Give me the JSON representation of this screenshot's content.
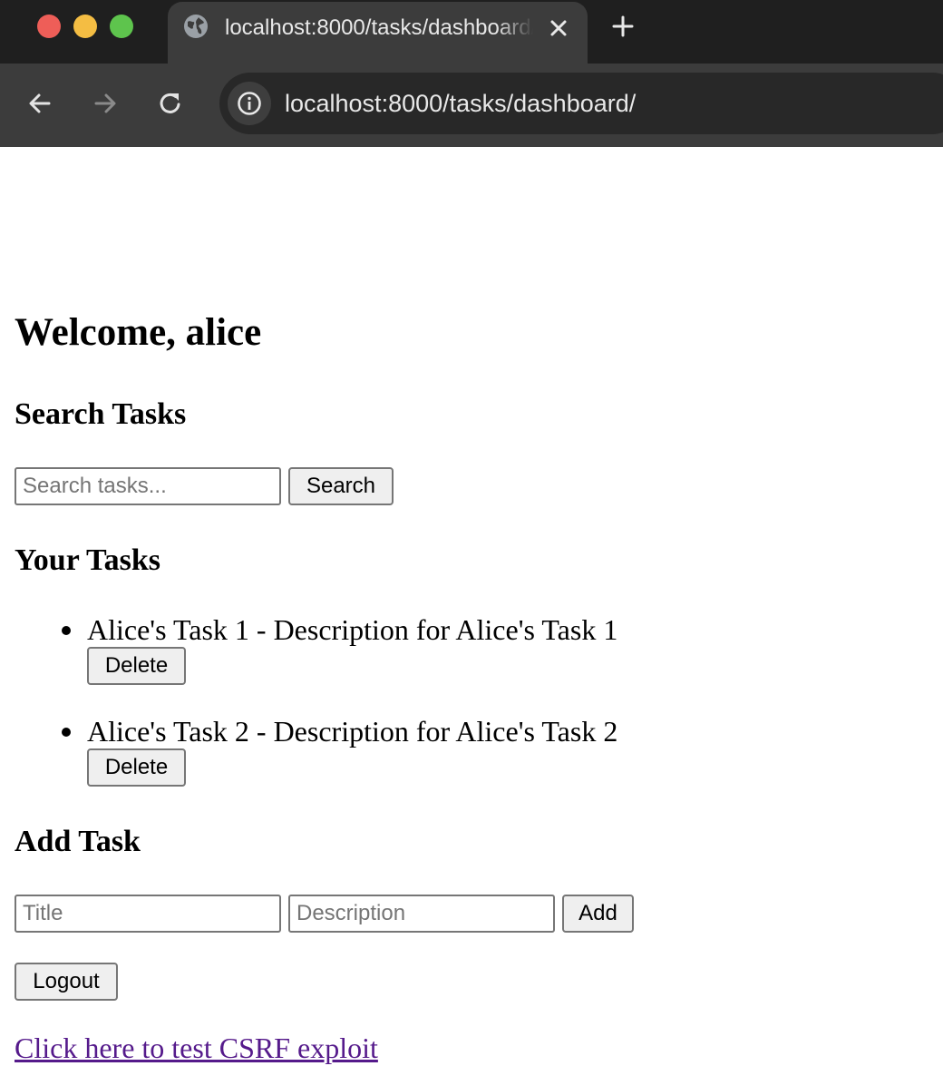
{
  "browser": {
    "tab_title": "localhost:8000/tasks/dashboard/",
    "url": "localhost:8000/tasks/dashboard/",
    "icons": {
      "tab_favicon": "globe-icon",
      "tab_close": "close-icon",
      "new_tab": "plus-icon",
      "back": "arrow-left-icon",
      "forward": "arrow-right-icon",
      "reload": "reload-icon",
      "site_info": "info-icon"
    }
  },
  "page": {
    "welcome_heading": "Welcome, alice",
    "search": {
      "heading": "Search Tasks",
      "input_value": "",
      "input_placeholder": "Search tasks...",
      "button_label": "Search"
    },
    "tasks": {
      "heading": "Your Tasks",
      "items": [
        {
          "text": "Alice's Task 1 - Description for Alice's Task 1",
          "delete_label": "Delete"
        },
        {
          "text": "Alice's Task 2 - Description for Alice's Task 2",
          "delete_label": "Delete"
        }
      ]
    },
    "add_task": {
      "heading": "Add Task",
      "title_placeholder": "Title",
      "description_placeholder": "Description",
      "button_label": "Add"
    },
    "logout_label": "Logout",
    "csrf_link_text": "Click here to test CSRF exploit"
  },
  "colors": {
    "tabstrip_bg": "#1f1f1f",
    "toolbar_bg": "#3c3c3c",
    "omnibox_bg": "#282828",
    "link_visited": "#551a8b"
  }
}
